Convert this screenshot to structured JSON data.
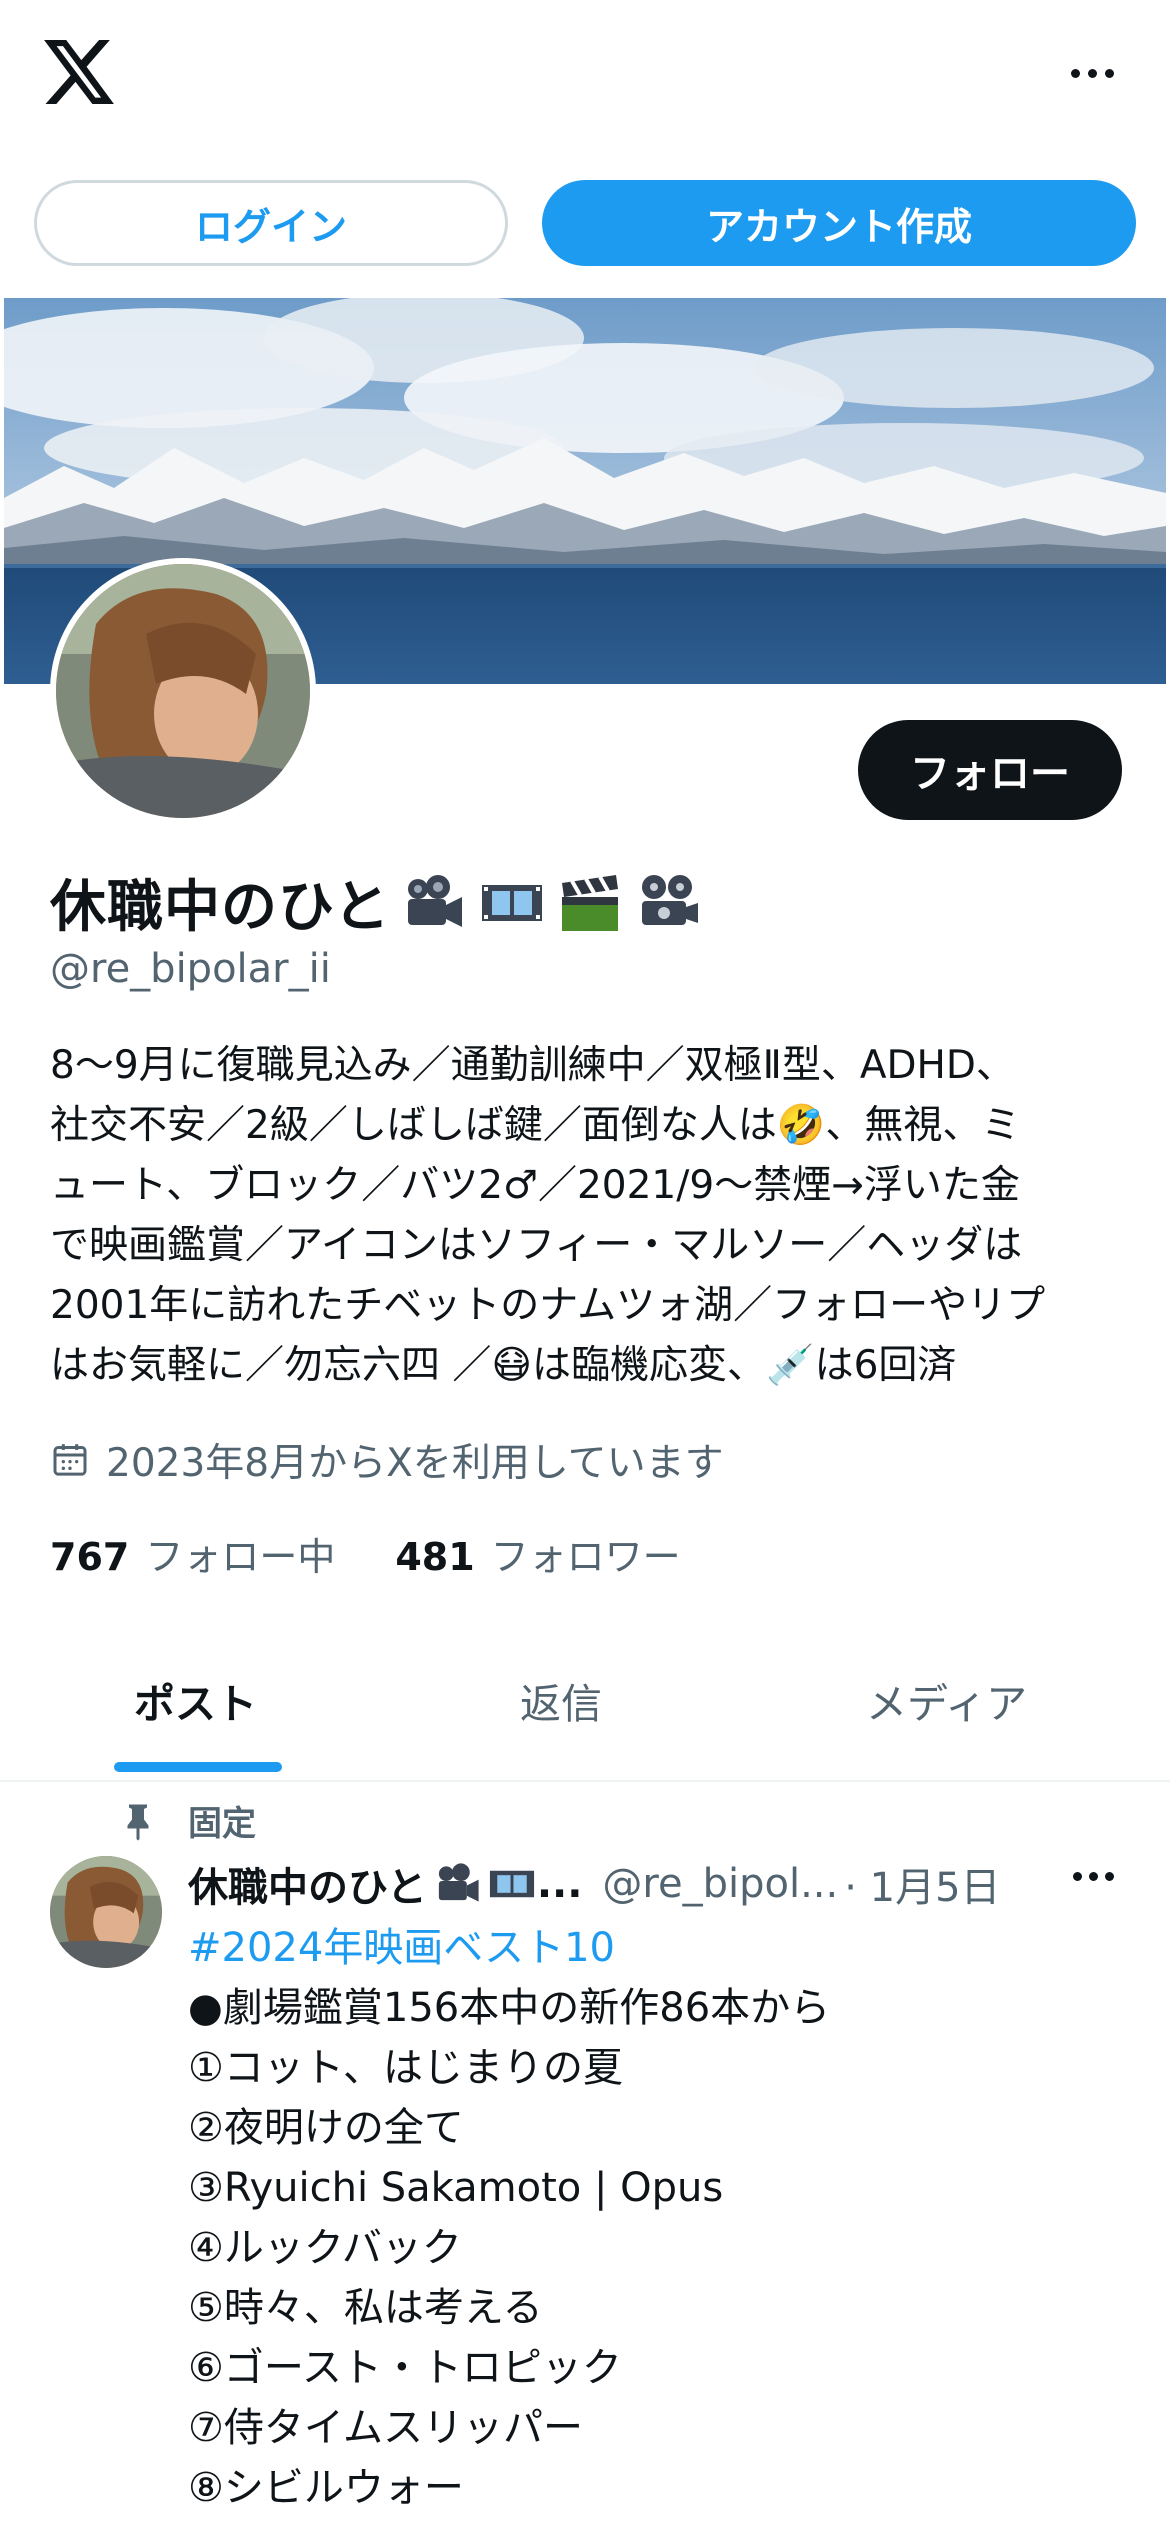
{
  "header": {
    "logo": "x-logo",
    "more_icon": "more-horizontal-icon"
  },
  "auth": {
    "login_label": "ログイン",
    "signup_label": "アカウント作成"
  },
  "profile": {
    "display_name": "休職中のひと",
    "name_emojis": [
      "movie-camera-emoji",
      "film-frames-emoji",
      "clapper-board-emoji",
      "film-projector-emoji"
    ],
    "handle": "@re_bipolar_ii",
    "follow_label": "フォロー",
    "bio_lines": [
      "8〜9月に復職見込み／通勤訓練中／双極Ⅱ型、ADHD、",
      "社交不安／2級／しばしば鍵／面倒な人は🤣、無視、ミ",
      "ュート、ブロック／バツ2♂／2021/9〜禁煙→浮いた金",
      "で映画鑑賞／アイコンはソフィー・マルソー／ヘッダは",
      "2001年に訪れたチベットのナムツォ湖／フォローやリプ",
      "はお気軽に／勿忘六四 ／😷は臨機応変、💉は6回済"
    ],
    "joined_icon": "calendar-icon",
    "joined": "2023年8月からXを利用しています",
    "following_count": "767",
    "following_label": "フォロー中",
    "followers_count": "481",
    "followers_label": "フォロワー"
  },
  "tabs": [
    {
      "label": "ポスト",
      "active": true
    },
    {
      "label": "返信",
      "active": false
    },
    {
      "label": "メディア",
      "active": false
    }
  ],
  "pinned_post": {
    "pinned_icon": "pin-icon",
    "pinned_label": "固定",
    "author_name": "休職中のひと",
    "author_name_truncation": "...",
    "author_handle": "@re_bipol...",
    "date": "· 1月5日",
    "hashtag": "#2024年映画ベスト10",
    "lines": [
      "●劇場鑑賞156本中の新作86本から",
      "①コット、はじまりの夏",
      "②夜明けの全て",
      "③Ryuichi Sakamoto | Opus",
      "④ルックバック",
      "⑤時々、私は考える",
      "⑥ゴースト・トロピック",
      "⑦侍タイムスリッパー",
      "⑧シビルウォー"
    ]
  },
  "colors": {
    "accent": "#1d9bf0",
    "text": "#0f1419",
    "secondary": "#536471",
    "border": "#cfd9de"
  }
}
